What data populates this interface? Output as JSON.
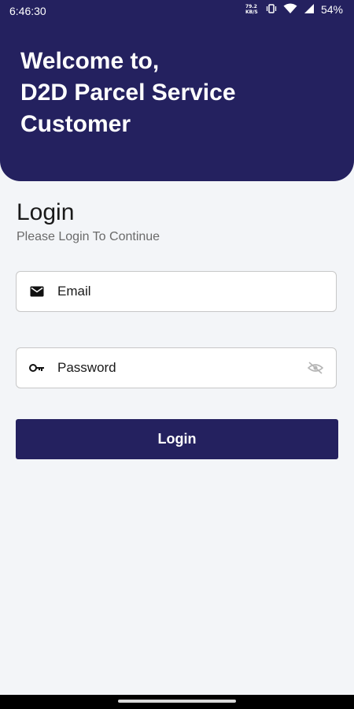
{
  "status_bar": {
    "time": "6:46:30",
    "battery": "54%",
    "network_label": "?",
    "icons": [
      "network-speed-icon",
      "vibrate-icon",
      "wifi-icon",
      "signal-icon",
      "battery-icon"
    ]
  },
  "header": {
    "welcome_line1": "Welcome to,",
    "welcome_line2": "D2D Parcel Service",
    "welcome_line3": "Customer",
    "background_color": "#24215f"
  },
  "login": {
    "title": "Login",
    "subtitle": "Please Login To Continue"
  },
  "email_field": {
    "placeholder": "Email",
    "value": "",
    "icon": "mail-icon"
  },
  "password_field": {
    "placeholder": "Password",
    "value": "",
    "icon": "key-icon",
    "toggle_icon": "eye-off-icon"
  },
  "login_button": {
    "label": "Login",
    "color": "#24215f"
  }
}
